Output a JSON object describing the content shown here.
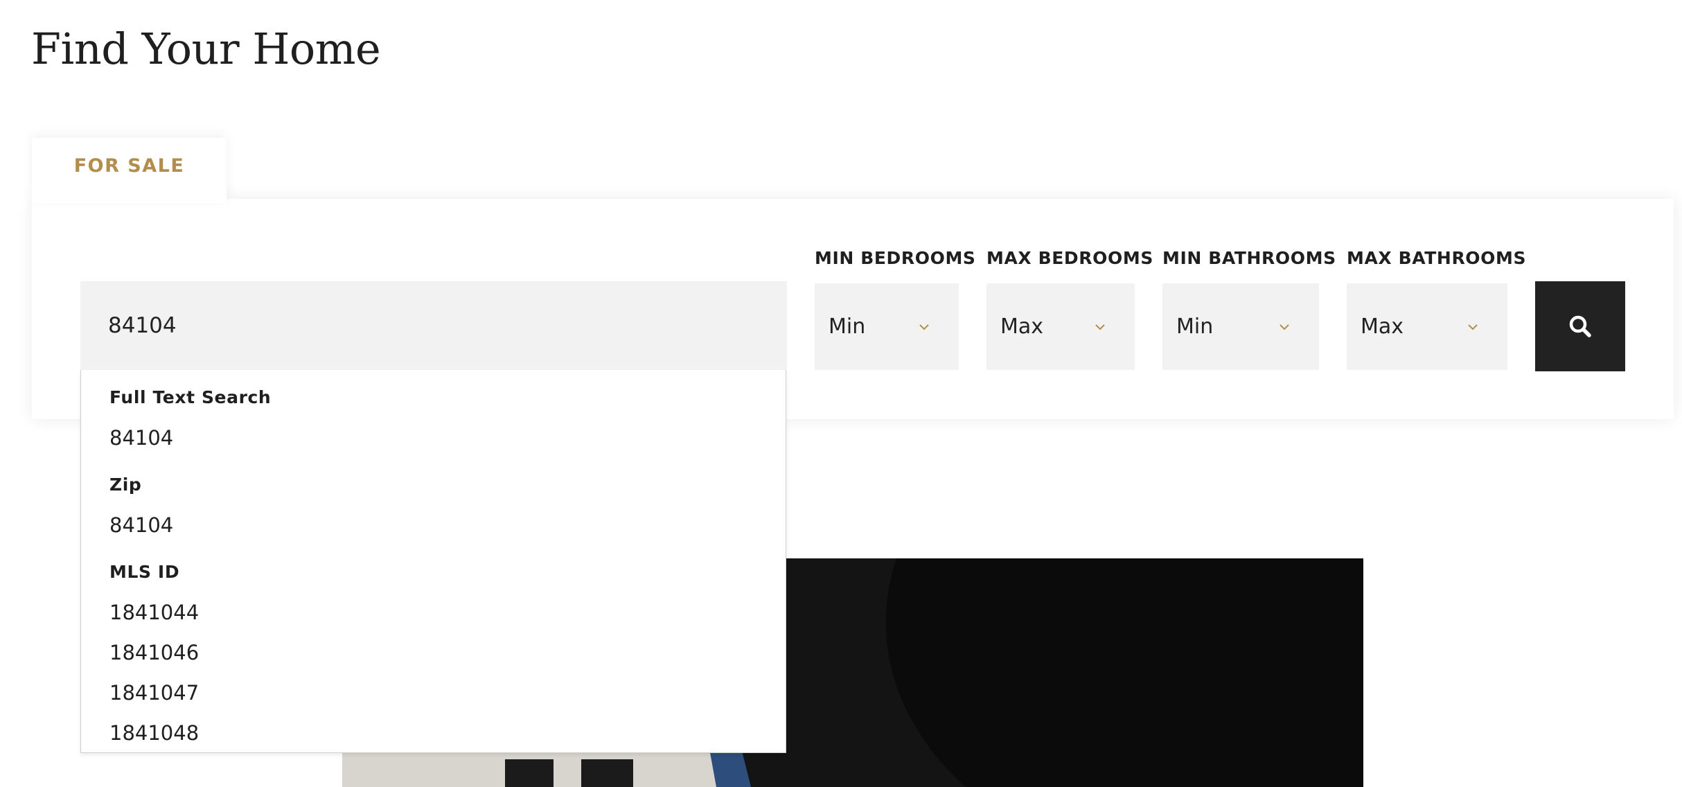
{
  "page": {
    "title": "Find Your Home"
  },
  "tabs": {
    "for_sale": "FOR SALE"
  },
  "search": {
    "value": "84104"
  },
  "filters": {
    "min_bedrooms": {
      "label": "MIN BEDROOMS",
      "value": "Min"
    },
    "max_bedrooms": {
      "label": "MAX BEDROOMS",
      "value": "Max"
    },
    "min_bathrooms": {
      "label": "MIN BATHROOMS",
      "value": "Min"
    },
    "max_bathrooms": {
      "label": "MAX BATHROOMS",
      "value": "Max"
    }
  },
  "icons": {
    "search": "search-icon",
    "chevron": "chevron-down-icon"
  },
  "colors": {
    "accent": "#b28d4c",
    "input_bg": "#f2f2f2",
    "button_bg": "#222222"
  },
  "suggestions": {
    "groups": [
      {
        "heading": "Full Text Search",
        "items": [
          "84104"
        ]
      },
      {
        "heading": "Zip",
        "items": [
          "84104"
        ]
      },
      {
        "heading": "MLS ID",
        "items": [
          "1841044",
          "1841046",
          "1841047",
          "1841048"
        ]
      }
    ]
  }
}
